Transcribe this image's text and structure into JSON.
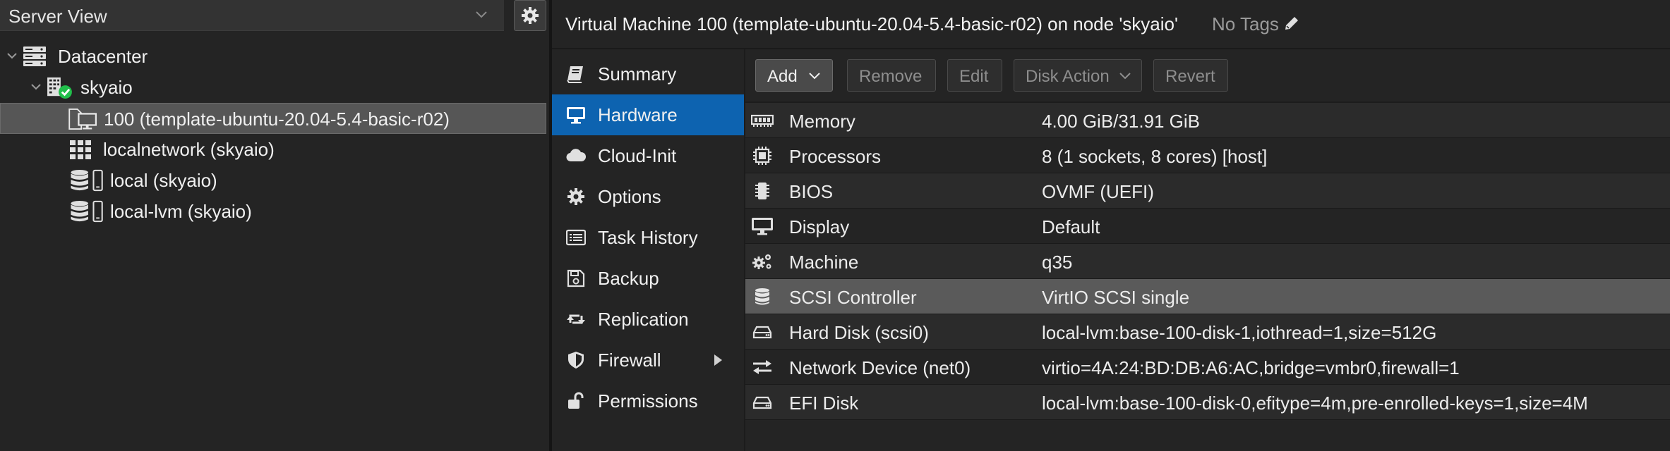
{
  "left_panel": {
    "view_selector": {
      "value": "Server View"
    },
    "tree": [
      {
        "label": "Datacenter",
        "icon": "datacenter-icon"
      },
      {
        "label": "skyaio",
        "icon": "node-online-icon"
      },
      {
        "label": "100 (template-ubuntu-20.04-5.4-basic-r02)",
        "icon": "vm-template-icon",
        "selected": true
      },
      {
        "label": "localnetwork (skyaio)",
        "icon": "sdn-zone-icon"
      },
      {
        "label": "local (skyaio)",
        "icon": "storage-icon"
      },
      {
        "label": "local-lvm (skyaio)",
        "icon": "storage-icon"
      }
    ]
  },
  "header": {
    "title": "Virtual Machine 100 (template-ubuntu-20.04-5.4-basic-r02) on node 'skyaio'",
    "tags_label": "No Tags"
  },
  "nav": {
    "items": [
      {
        "label": "Summary",
        "icon": "book-icon"
      },
      {
        "label": "Hardware",
        "icon": "desktop-icon",
        "selected": true
      },
      {
        "label": "Cloud-Init",
        "icon": "cloud-icon"
      },
      {
        "label": "Options",
        "icon": "gear-icon"
      },
      {
        "label": "Task History",
        "icon": "list-icon"
      },
      {
        "label": "Backup",
        "icon": "floppy-icon"
      },
      {
        "label": "Replication",
        "icon": "retweet-icon"
      },
      {
        "label": "Firewall",
        "icon": "shield-icon"
      },
      {
        "label": "Permissions",
        "icon": "unlock-icon"
      }
    ]
  },
  "toolbar": {
    "add": "Add",
    "remove": "Remove",
    "edit": "Edit",
    "disk_action": "Disk Action",
    "revert": "Revert"
  },
  "hardware": [
    {
      "name": "Memory",
      "value": "4.00 GiB/31.91 GiB",
      "icon": "memory-icon"
    },
    {
      "name": "Processors",
      "value": "8 (1 sockets, 8 cores) [host]",
      "icon": "cpu-icon"
    },
    {
      "name": "BIOS",
      "value": "OVMF (UEFI)",
      "icon": "microchip-icon"
    },
    {
      "name": "Display",
      "value": "Default",
      "icon": "desktop-icon"
    },
    {
      "name": "Machine",
      "value": "q35",
      "icon": "cogs-icon"
    },
    {
      "name": "SCSI Controller",
      "value": "VirtIO SCSI single",
      "icon": "database-icon",
      "selected": true
    },
    {
      "name": "Hard Disk (scsi0)",
      "value": "local-lvm:base-100-disk-1,iothread=1,size=512G",
      "icon": "hdd-icon"
    },
    {
      "name": "Network Device (net0)",
      "value": "virtio=4A:24:BD:DB:A6:AC,bridge=vmbr0,firewall=1",
      "icon": "exchange-icon"
    },
    {
      "name": "EFI Disk",
      "value": "local-lvm:base-100-disk-0,efitype=4m,pre-enrolled-keys=1,size=4M",
      "icon": "hdd-icon"
    }
  ],
  "colors": {
    "background": "#242424",
    "selected_nav": "#0d63b0",
    "selected_row": "#5a5a5a",
    "node_ok": "#21bf4b"
  }
}
